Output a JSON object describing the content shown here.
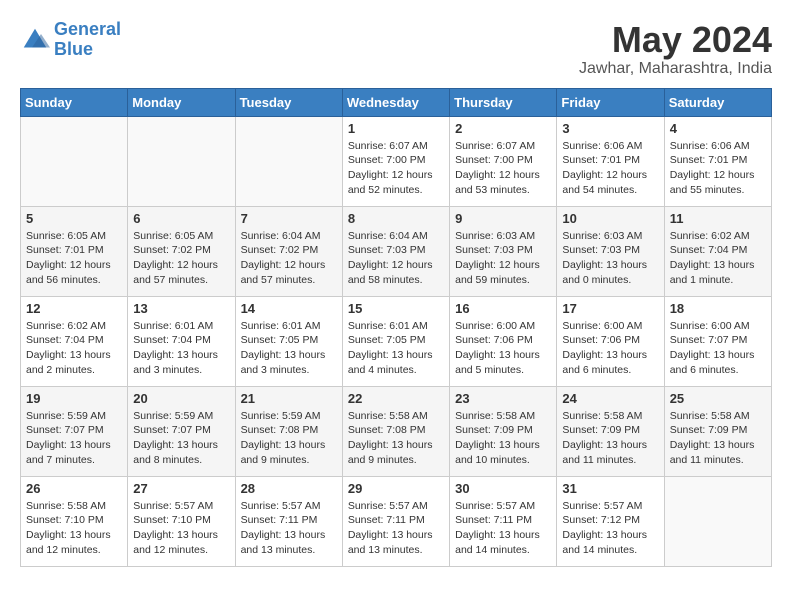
{
  "logo": {
    "line1": "General",
    "line2": "Blue"
  },
  "title": "May 2024",
  "location": "Jawhar, Maharashtra, India",
  "headers": [
    "Sunday",
    "Monday",
    "Tuesday",
    "Wednesday",
    "Thursday",
    "Friday",
    "Saturday"
  ],
  "weeks": [
    [
      {
        "day": "",
        "info": ""
      },
      {
        "day": "",
        "info": ""
      },
      {
        "day": "",
        "info": ""
      },
      {
        "day": "1",
        "info": "Sunrise: 6:07 AM\nSunset: 7:00 PM\nDaylight: 12 hours\nand 52 minutes."
      },
      {
        "day": "2",
        "info": "Sunrise: 6:07 AM\nSunset: 7:00 PM\nDaylight: 12 hours\nand 53 minutes."
      },
      {
        "day": "3",
        "info": "Sunrise: 6:06 AM\nSunset: 7:01 PM\nDaylight: 12 hours\nand 54 minutes."
      },
      {
        "day": "4",
        "info": "Sunrise: 6:06 AM\nSunset: 7:01 PM\nDaylight: 12 hours\nand 55 minutes."
      }
    ],
    [
      {
        "day": "5",
        "info": "Sunrise: 6:05 AM\nSunset: 7:01 PM\nDaylight: 12 hours\nand 56 minutes."
      },
      {
        "day": "6",
        "info": "Sunrise: 6:05 AM\nSunset: 7:02 PM\nDaylight: 12 hours\nand 57 minutes."
      },
      {
        "day": "7",
        "info": "Sunrise: 6:04 AM\nSunset: 7:02 PM\nDaylight: 12 hours\nand 57 minutes."
      },
      {
        "day": "8",
        "info": "Sunrise: 6:04 AM\nSunset: 7:03 PM\nDaylight: 12 hours\nand 58 minutes."
      },
      {
        "day": "9",
        "info": "Sunrise: 6:03 AM\nSunset: 7:03 PM\nDaylight: 12 hours\nand 59 minutes."
      },
      {
        "day": "10",
        "info": "Sunrise: 6:03 AM\nSunset: 7:03 PM\nDaylight: 13 hours\nand 0 minutes."
      },
      {
        "day": "11",
        "info": "Sunrise: 6:02 AM\nSunset: 7:04 PM\nDaylight: 13 hours\nand 1 minute."
      }
    ],
    [
      {
        "day": "12",
        "info": "Sunrise: 6:02 AM\nSunset: 7:04 PM\nDaylight: 13 hours\nand 2 minutes."
      },
      {
        "day": "13",
        "info": "Sunrise: 6:01 AM\nSunset: 7:04 PM\nDaylight: 13 hours\nand 3 minutes."
      },
      {
        "day": "14",
        "info": "Sunrise: 6:01 AM\nSunset: 7:05 PM\nDaylight: 13 hours\nand 3 minutes."
      },
      {
        "day": "15",
        "info": "Sunrise: 6:01 AM\nSunset: 7:05 PM\nDaylight: 13 hours\nand 4 minutes."
      },
      {
        "day": "16",
        "info": "Sunrise: 6:00 AM\nSunset: 7:06 PM\nDaylight: 13 hours\nand 5 minutes."
      },
      {
        "day": "17",
        "info": "Sunrise: 6:00 AM\nSunset: 7:06 PM\nDaylight: 13 hours\nand 6 minutes."
      },
      {
        "day": "18",
        "info": "Sunrise: 6:00 AM\nSunset: 7:07 PM\nDaylight: 13 hours\nand 6 minutes."
      }
    ],
    [
      {
        "day": "19",
        "info": "Sunrise: 5:59 AM\nSunset: 7:07 PM\nDaylight: 13 hours\nand 7 minutes."
      },
      {
        "day": "20",
        "info": "Sunrise: 5:59 AM\nSunset: 7:07 PM\nDaylight: 13 hours\nand 8 minutes."
      },
      {
        "day": "21",
        "info": "Sunrise: 5:59 AM\nSunset: 7:08 PM\nDaylight: 13 hours\nand 9 minutes."
      },
      {
        "day": "22",
        "info": "Sunrise: 5:58 AM\nSunset: 7:08 PM\nDaylight: 13 hours\nand 9 minutes."
      },
      {
        "day": "23",
        "info": "Sunrise: 5:58 AM\nSunset: 7:09 PM\nDaylight: 13 hours\nand 10 minutes."
      },
      {
        "day": "24",
        "info": "Sunrise: 5:58 AM\nSunset: 7:09 PM\nDaylight: 13 hours\nand 11 minutes."
      },
      {
        "day": "25",
        "info": "Sunrise: 5:58 AM\nSunset: 7:09 PM\nDaylight: 13 hours\nand 11 minutes."
      }
    ],
    [
      {
        "day": "26",
        "info": "Sunrise: 5:58 AM\nSunset: 7:10 PM\nDaylight: 13 hours\nand 12 minutes."
      },
      {
        "day": "27",
        "info": "Sunrise: 5:57 AM\nSunset: 7:10 PM\nDaylight: 13 hours\nand 12 minutes."
      },
      {
        "day": "28",
        "info": "Sunrise: 5:57 AM\nSunset: 7:11 PM\nDaylight: 13 hours\nand 13 minutes."
      },
      {
        "day": "29",
        "info": "Sunrise: 5:57 AM\nSunset: 7:11 PM\nDaylight: 13 hours\nand 13 minutes."
      },
      {
        "day": "30",
        "info": "Sunrise: 5:57 AM\nSunset: 7:11 PM\nDaylight: 13 hours\nand 14 minutes."
      },
      {
        "day": "31",
        "info": "Sunrise: 5:57 AM\nSunset: 7:12 PM\nDaylight: 13 hours\nand 14 minutes."
      },
      {
        "day": "",
        "info": ""
      }
    ]
  ]
}
